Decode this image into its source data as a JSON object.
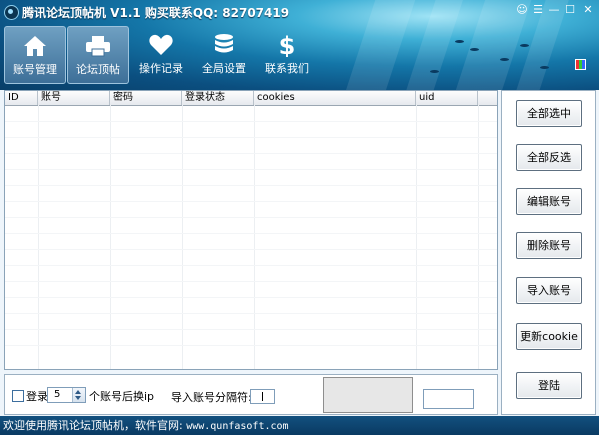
{
  "window": {
    "title": "腾讯论坛顶帖机 V1.1 购买联系QQ: 82707419",
    "controls": [
      "menu-icon",
      "settings-icon",
      "minimize-icon",
      "maximize-icon",
      "close-icon"
    ]
  },
  "toolbar": {
    "items": [
      {
        "label": "账号管理",
        "icon": "home-icon",
        "active": true
      },
      {
        "label": "论坛顶帖",
        "icon": "printer-icon",
        "active": true
      },
      {
        "label": "操作记录",
        "icon": "heart-icon",
        "active": false
      },
      {
        "label": "全局设置",
        "icon": "database-icon",
        "active": false
      },
      {
        "label": "联系我们",
        "icon": "dollar-icon",
        "active": false
      }
    ]
  },
  "grid": {
    "columns": [
      "ID",
      "账号",
      "密码",
      "登录状态",
      "cookies",
      "uid"
    ],
    "rows": []
  },
  "actions": {
    "select_all": "全部选中",
    "invert_select": "全部反选",
    "edit_account": "编辑账号",
    "delete_account": "删除账号",
    "import_account": "导入账号",
    "update_cookie": "更新cookie",
    "login": "登陆"
  },
  "bottom": {
    "login_checkbox_label": "登录",
    "login_checkbox_checked": false,
    "switch_count": "5",
    "switch_suffix": "个账号后换ip",
    "separator_label": "导入账号分隔符:",
    "separator_value": ""
  },
  "status": {
    "text": "欢迎使用腾讯论坛顶帖机，软件官网: ",
    "url": "www.qunfasoft.com"
  },
  "colors": {
    "header_dark": "#0b4f80",
    "header_light": "#9fe3f5",
    "status_bar": "#0a3a62"
  }
}
